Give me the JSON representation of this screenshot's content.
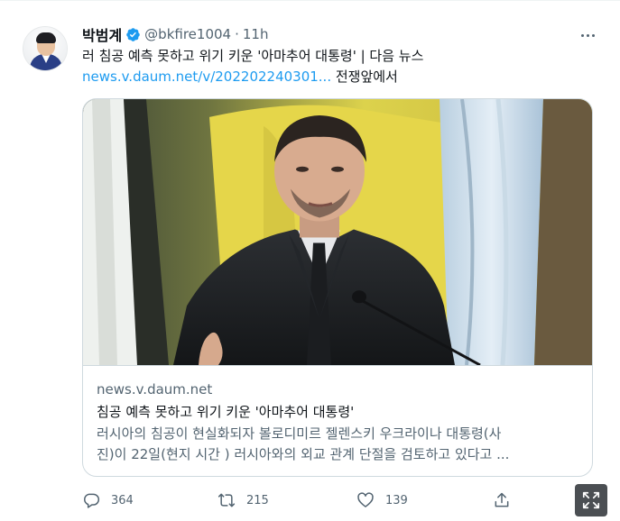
{
  "tweet": {
    "author_name": "박범계",
    "handle": "@bkfire1004",
    "separator": "·",
    "time": "11h",
    "text_line1": "러 침공 예측 못하고 위기 키운 '아마추어 대통령' | 다음 뉴스",
    "link_text": "news.v.daum.net/v/202202240301...",
    "text_after_link": " 전쟁앞에서"
  },
  "card": {
    "domain": "news.v.daum.net",
    "title": "침공 예측 못하고 위기 키운 '아마추어 대통령'",
    "desc_line1": "러시아의 침공이 현실화되자 볼로디미르 젤렌스키 우크라이나 대통령(사",
    "desc_line2": "진)이 22일(현지 시간 )  러시아와의 외교 관계 단절을 검토하고 있다고 ..."
  },
  "actions": {
    "reply_count": "364",
    "retweet_count": "215",
    "like_count": "139"
  },
  "icons": {
    "verified": "verified-badge-icon",
    "more": "more-icon",
    "reply": "reply-icon",
    "retweet": "retweet-icon",
    "like": "heart-icon",
    "share": "share-icon",
    "expand": "expand-icon"
  },
  "colors": {
    "link": "#1d9bf0",
    "secondary_text": "#536471",
    "verified": "#1d9bf0"
  }
}
